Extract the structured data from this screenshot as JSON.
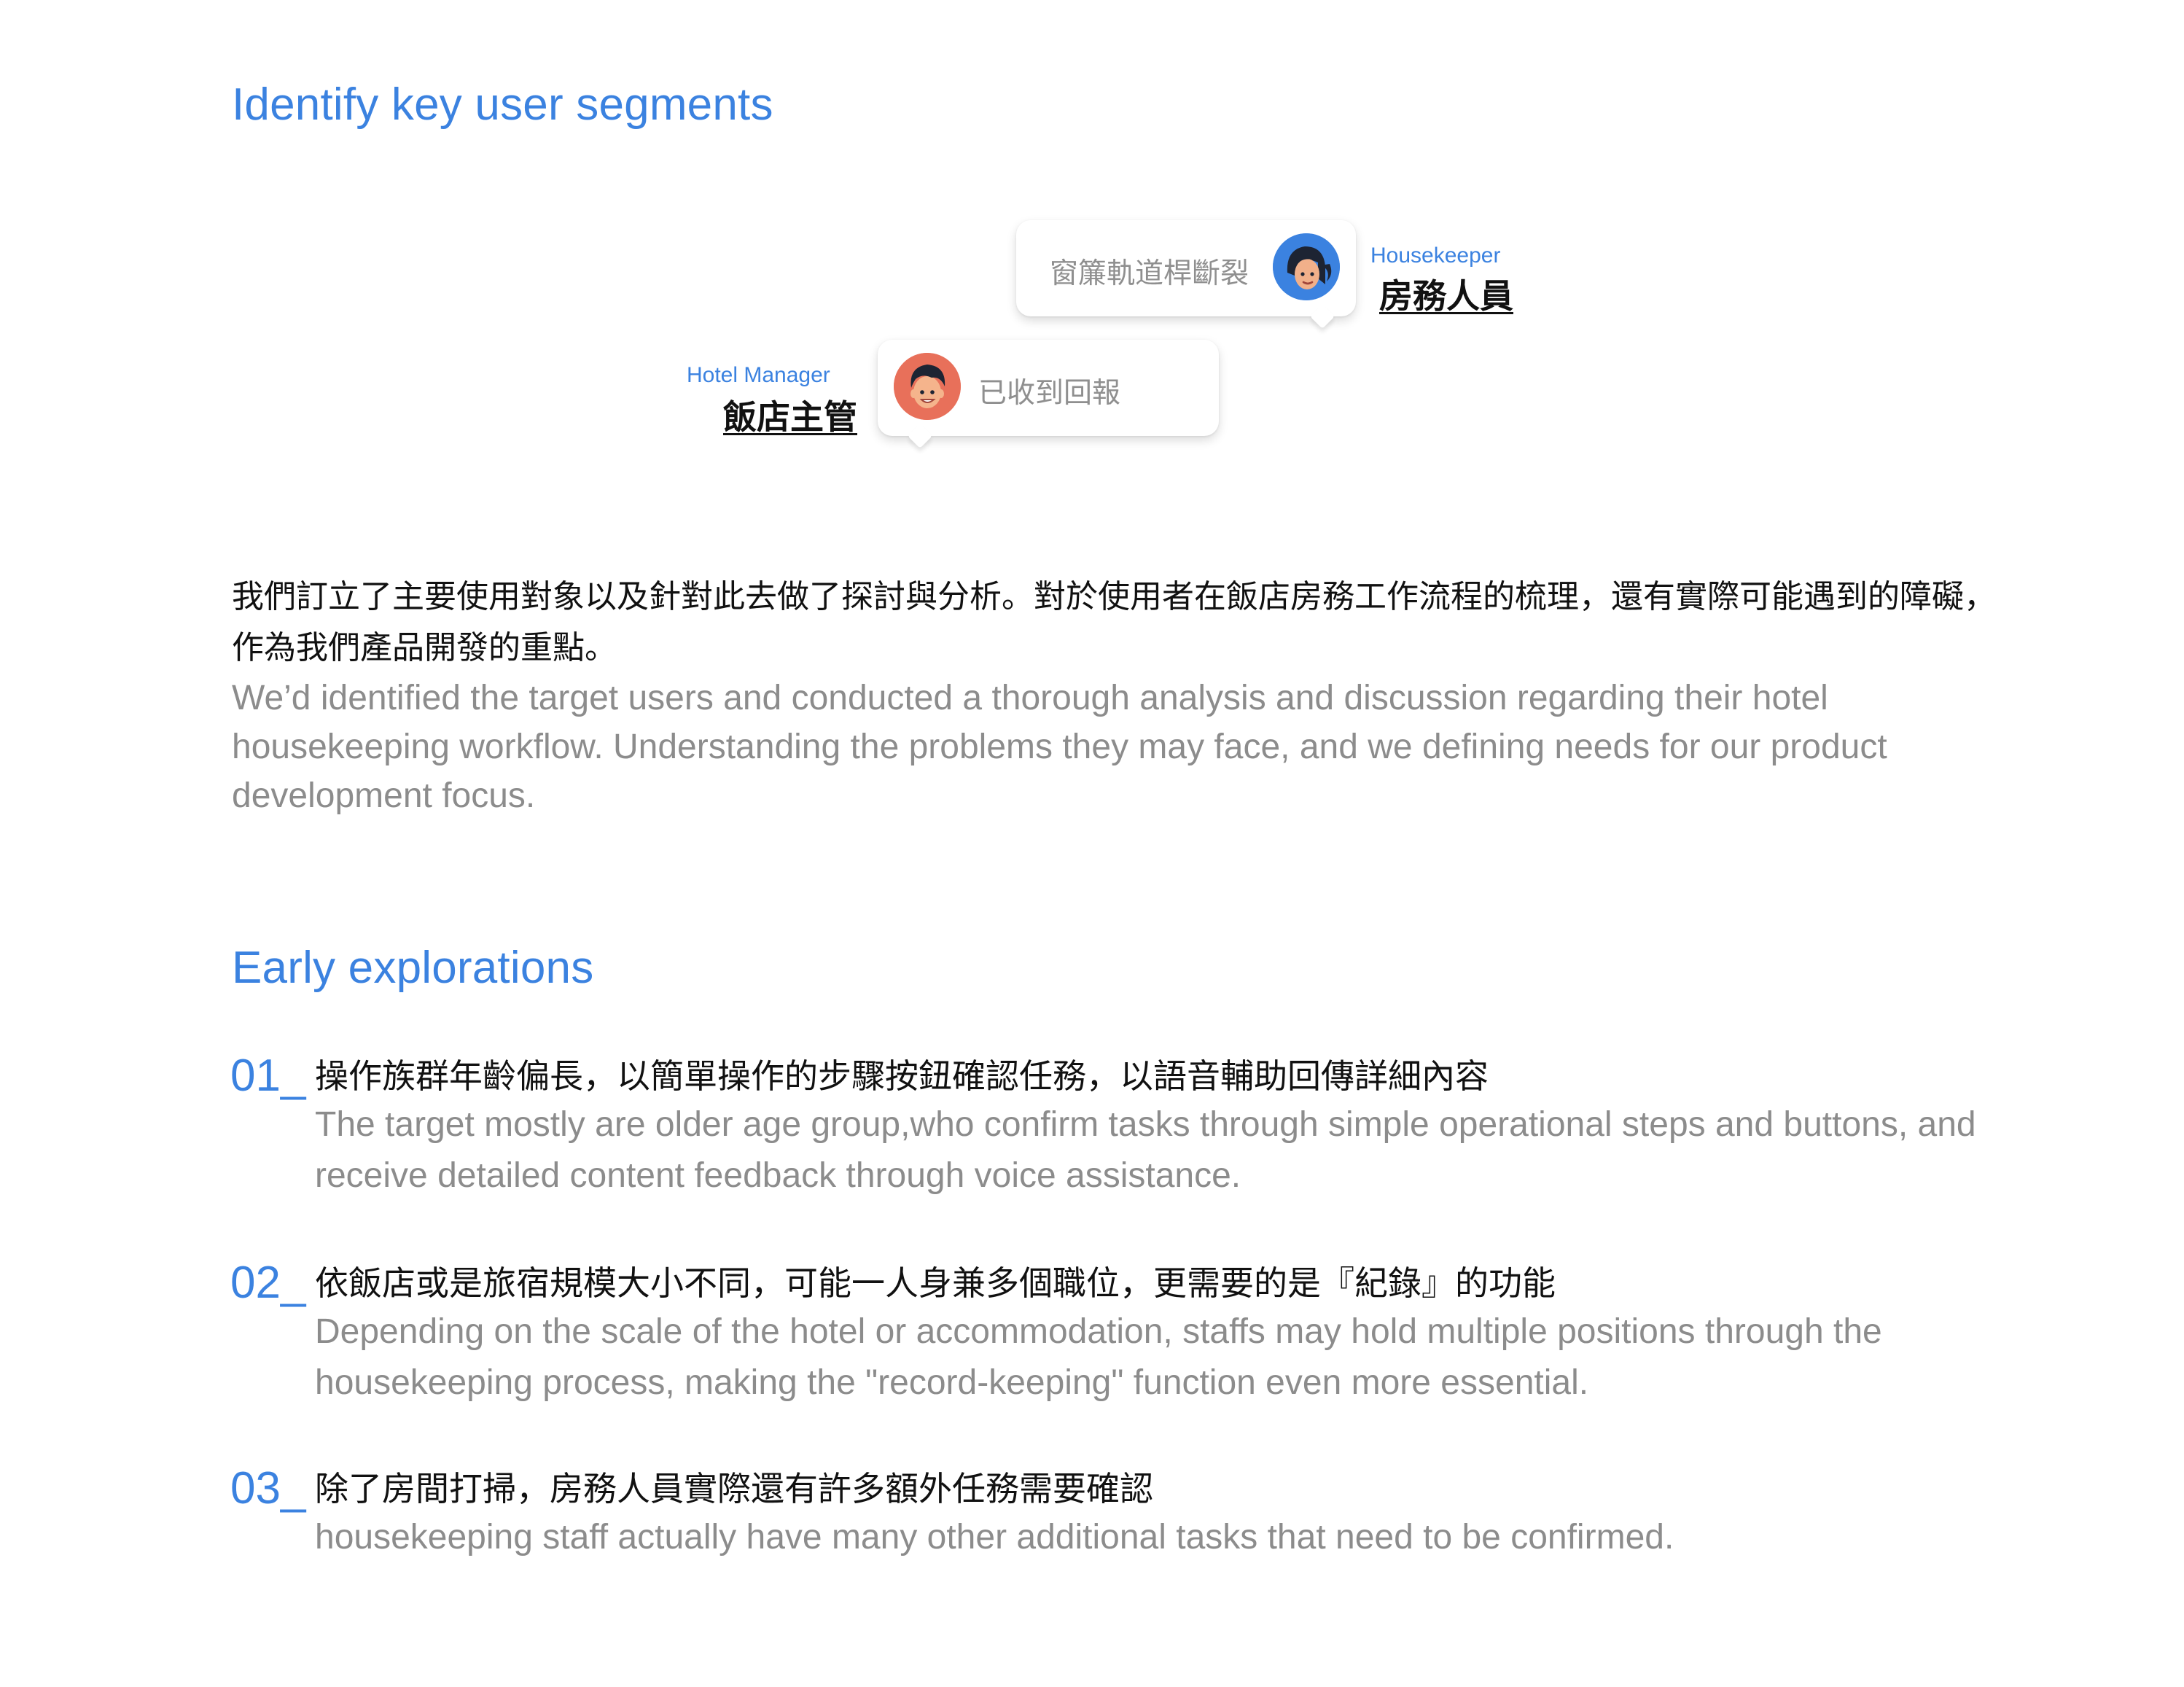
{
  "segments": {
    "title": "Identify key user segments",
    "housekeeper": {
      "role_en": "Housekeeper",
      "role_zh": "房務人員",
      "message": "窗簾軌道桿斷裂"
    },
    "manager": {
      "role_en": "Hotel Manager",
      "role_zh": "飯店主管",
      "message": "已收到回報"
    },
    "description_zh": "我們訂立了主要使用對象以及針對此去做了探討與分析。對於使用者在飯店房務工作流程的梳理，還有實際可能遇到的障礙，作為我們產品開發的重點。",
    "description_en": "We’d identified the target users and conducted a thorough analysis and discussion regarding their hotel housekeeping workflow. Understanding the problems they may face, and we defining needs for our product development focus."
  },
  "explorations": {
    "title": "Early explorations",
    "items": [
      {
        "number": "01_",
        "zh": "操作族群年齡偏長，以簡單操作的步驟按鈕確認任務，以語音輔助回傳詳細內容",
        "en": "The target mostly are older age group,who confirm tasks through simple operational steps and buttons, and receive detailed content feedback through voice assistance."
      },
      {
        "number": "02_",
        "zh": "依飯店或是旅宿規模大小不同，可能一人身兼多個職位，更需要的是『紀錄』的功能",
        "en": "Depending on the scale of the hotel or accommodation, staffs may hold multiple positions through the housekeeping process, making the \"record-keeping\" function even more essential."
      },
      {
        "number": "03_",
        "zh": "除了房間打掃，房務人員實際還有許多額外任務需要確認",
        "en": "housekeeping staff actually have many other additional tasks that need to be confirmed."
      }
    ]
  },
  "colors": {
    "accent": "#3b82e0",
    "body_text": "#111111",
    "muted_text": "#8c8c8c",
    "housekeeper_avatar_bg": "#3b82e0",
    "manager_avatar_bg": "#e8705a"
  }
}
